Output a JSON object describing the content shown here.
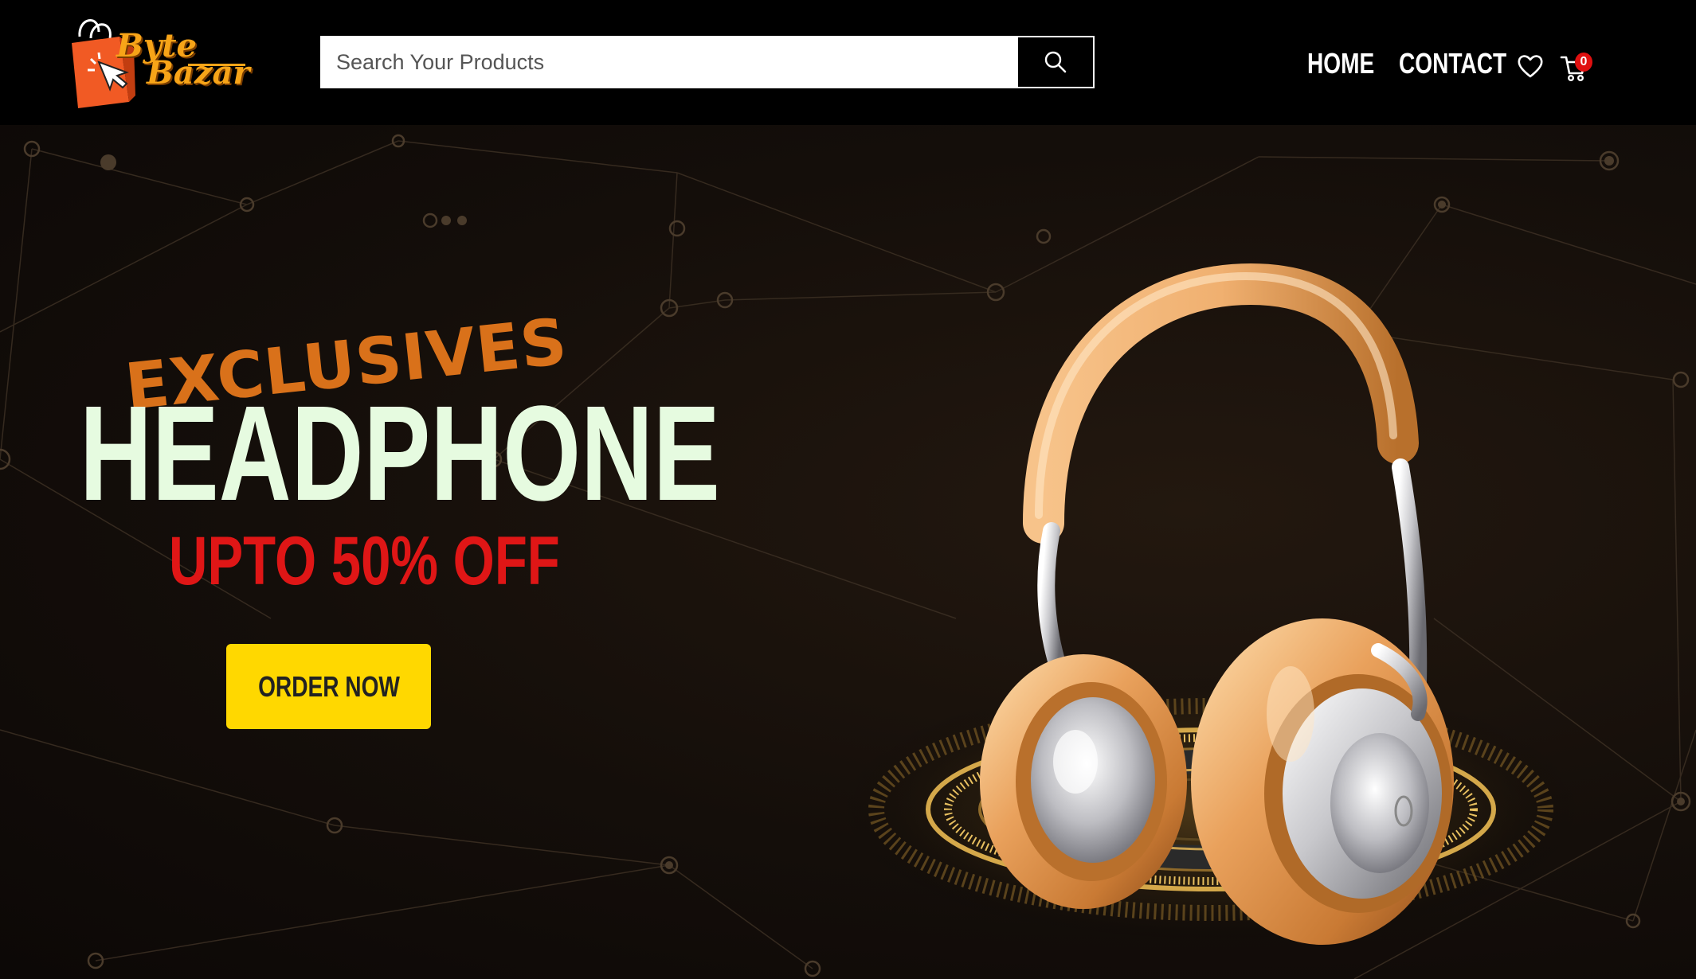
{
  "brand": {
    "logo_line1": "Byte",
    "logo_line2": "Bazar",
    "color": "#f7a418",
    "bag_color": "#f15a24"
  },
  "header": {
    "search": {
      "placeholder": "Search Your Products",
      "value": "",
      "button_icon": "search-icon"
    },
    "nav": {
      "home_label": "HOME",
      "contact_label": "CONTACT"
    },
    "wishlist_icon": "heart-icon",
    "cart": {
      "icon": "cart-icon",
      "count": "0",
      "badge_color": "#e01010"
    }
  },
  "hero": {
    "kicker": "EXCLUSIVES",
    "title": "HEADPHONE",
    "offer": "UPTO 50% OFF",
    "cta_label": "ORDER NOW",
    "colors": {
      "kicker": "#d9711a",
      "title": "#e6fbe0",
      "offer": "#df1616",
      "cta": "#ffd800"
    },
    "product_image": "gold-silver-headphones"
  }
}
